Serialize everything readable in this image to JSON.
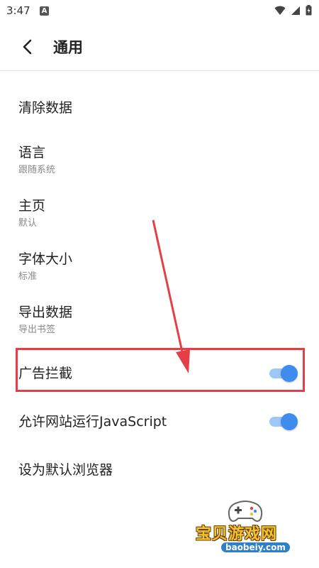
{
  "status_bar": {
    "time": "3:47",
    "badge": "A"
  },
  "header": {
    "title": "通用"
  },
  "settings": [
    {
      "title": "清除数据",
      "subtitle": ""
    },
    {
      "title": "语言",
      "subtitle": "跟随系统"
    },
    {
      "title": "主页",
      "subtitle": "默认"
    },
    {
      "title": "字体大小",
      "subtitle": "标准"
    },
    {
      "title": "导出数据",
      "subtitle": "导出书签"
    },
    {
      "title": "广告拦截",
      "toggle_on": true
    },
    {
      "title": "允许网站运行JavaScript",
      "toggle_on": true
    },
    {
      "title": "设为默认浏览器",
      "subtitle": ""
    }
  ],
  "watermark": {
    "text": "宝贝游戏网",
    "url": "baobeiy.com"
  },
  "colors": {
    "accent": "#3f8cef",
    "highlight": "#e63e46"
  }
}
